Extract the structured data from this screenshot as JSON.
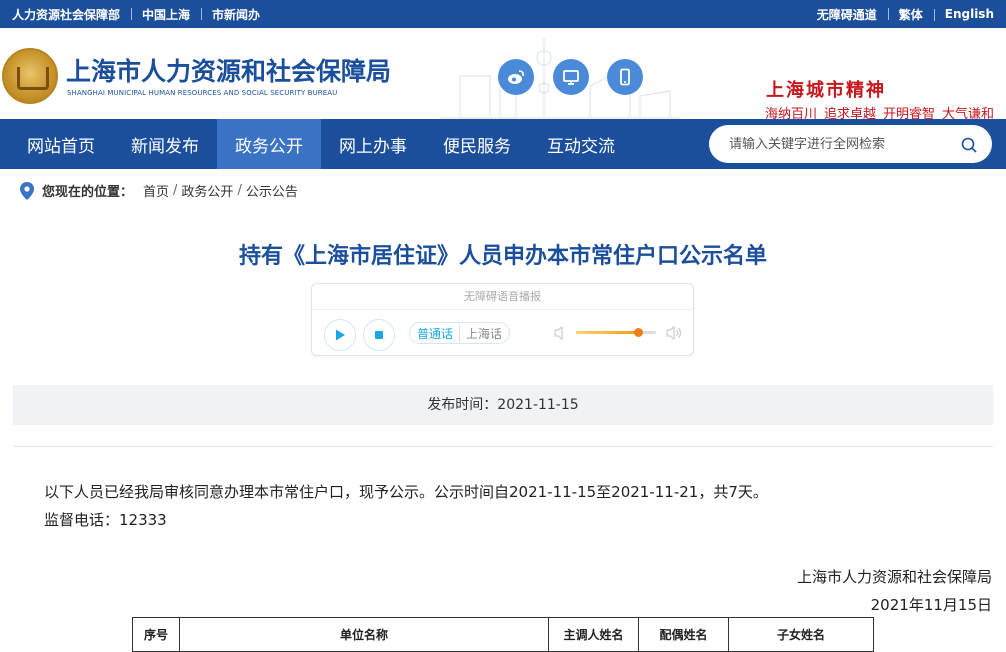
{
  "topbar": {
    "left_links": [
      "人力资源社会保障部",
      "中国上海",
      "市新闻办"
    ],
    "right_links": [
      "无障碍通道",
      "繁体",
      "English"
    ]
  },
  "header": {
    "org_name_cn": "上海市人力资源和社会保障局",
    "org_name_en": "SHANGHAI MUNICIPAL HUMAN RESOURCES AND SOCIAL SECURITY BUREAU",
    "social_icons": [
      "weibo-icon",
      "desktop-icon",
      "mobile-icon"
    ],
    "spirit_title": "上海城市精神",
    "spirit_items": [
      "海纳百川",
      "追求卓越",
      "开明睿智",
      "大气谦和"
    ],
    "brand_color": "#1c4f9b",
    "accent_red": "#c8161d"
  },
  "nav": {
    "items": [
      {
        "label": "网站首页",
        "active": false
      },
      {
        "label": "新闻发布",
        "active": false
      },
      {
        "label": "政务公开",
        "active": true
      },
      {
        "label": "网上办事",
        "active": false
      },
      {
        "label": "便民服务",
        "active": false
      },
      {
        "label": "互动交流",
        "active": false
      }
    ],
    "search_placeholder": "请输入关键字进行全网检索"
  },
  "breadcrumb": {
    "label": "您现在的位置：",
    "items": [
      "首页",
      "政务公开",
      "公示公告"
    ]
  },
  "article": {
    "title": "持有《上海市居住证》人员申办本市常住户口公示名单",
    "audio": {
      "caption": "无障碍语音播报",
      "dialects": [
        "普通话",
        "上海话"
      ],
      "selected_dialect": "普通话",
      "volume": 0.78
    },
    "publish_time": "发布时间：2021-11-15",
    "paragraphs": [
      "以下人员已经我局审核同意办理本市常住户口，现予公示。公示时间自2021-11-15至2021-11-21，共7天。",
      "监督电话：12333"
    ],
    "signature": {
      "org": "上海市人力资源和社会保障局",
      "date": "2021年11月15日"
    },
    "table": {
      "headers": [
        "序号",
        "单位名称",
        "主调人姓名",
        "配偶姓名",
        "子女姓名"
      ]
    }
  }
}
